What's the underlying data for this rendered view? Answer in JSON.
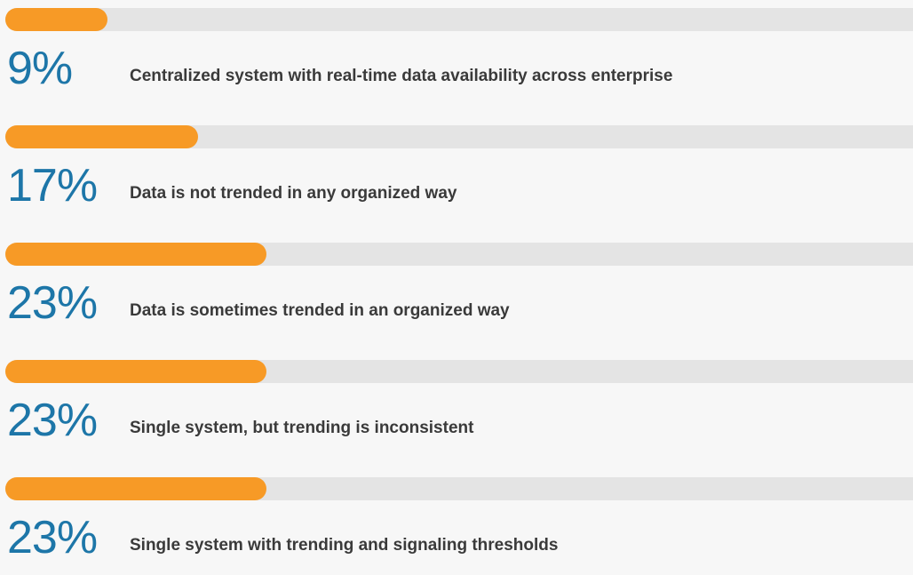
{
  "colors": {
    "background": "#f7f7f7",
    "track": "#e4e4e4",
    "bar": "#f79a26",
    "percent_text": "#1d76a8",
    "label_text": "#3a3a3a"
  },
  "chart_data": {
    "type": "bar",
    "orientation": "horizontal",
    "max_value": 100,
    "items": [
      {
        "percent": 9,
        "value_label": "9%",
        "label": "Centralized system with real-time data availability across enterprise"
      },
      {
        "percent": 17,
        "value_label": "17%",
        "label": "Data is not trended in any organized way"
      },
      {
        "percent": 23,
        "value_label": "23%",
        "label": "Data is sometimes trended in an organized way"
      },
      {
        "percent": 23,
        "value_label": "23%",
        "label": "Single system, but trending is inconsistent"
      },
      {
        "percent": 23,
        "value_label": "23%",
        "label": "Single system with trending and signaling thresholds"
      }
    ]
  }
}
